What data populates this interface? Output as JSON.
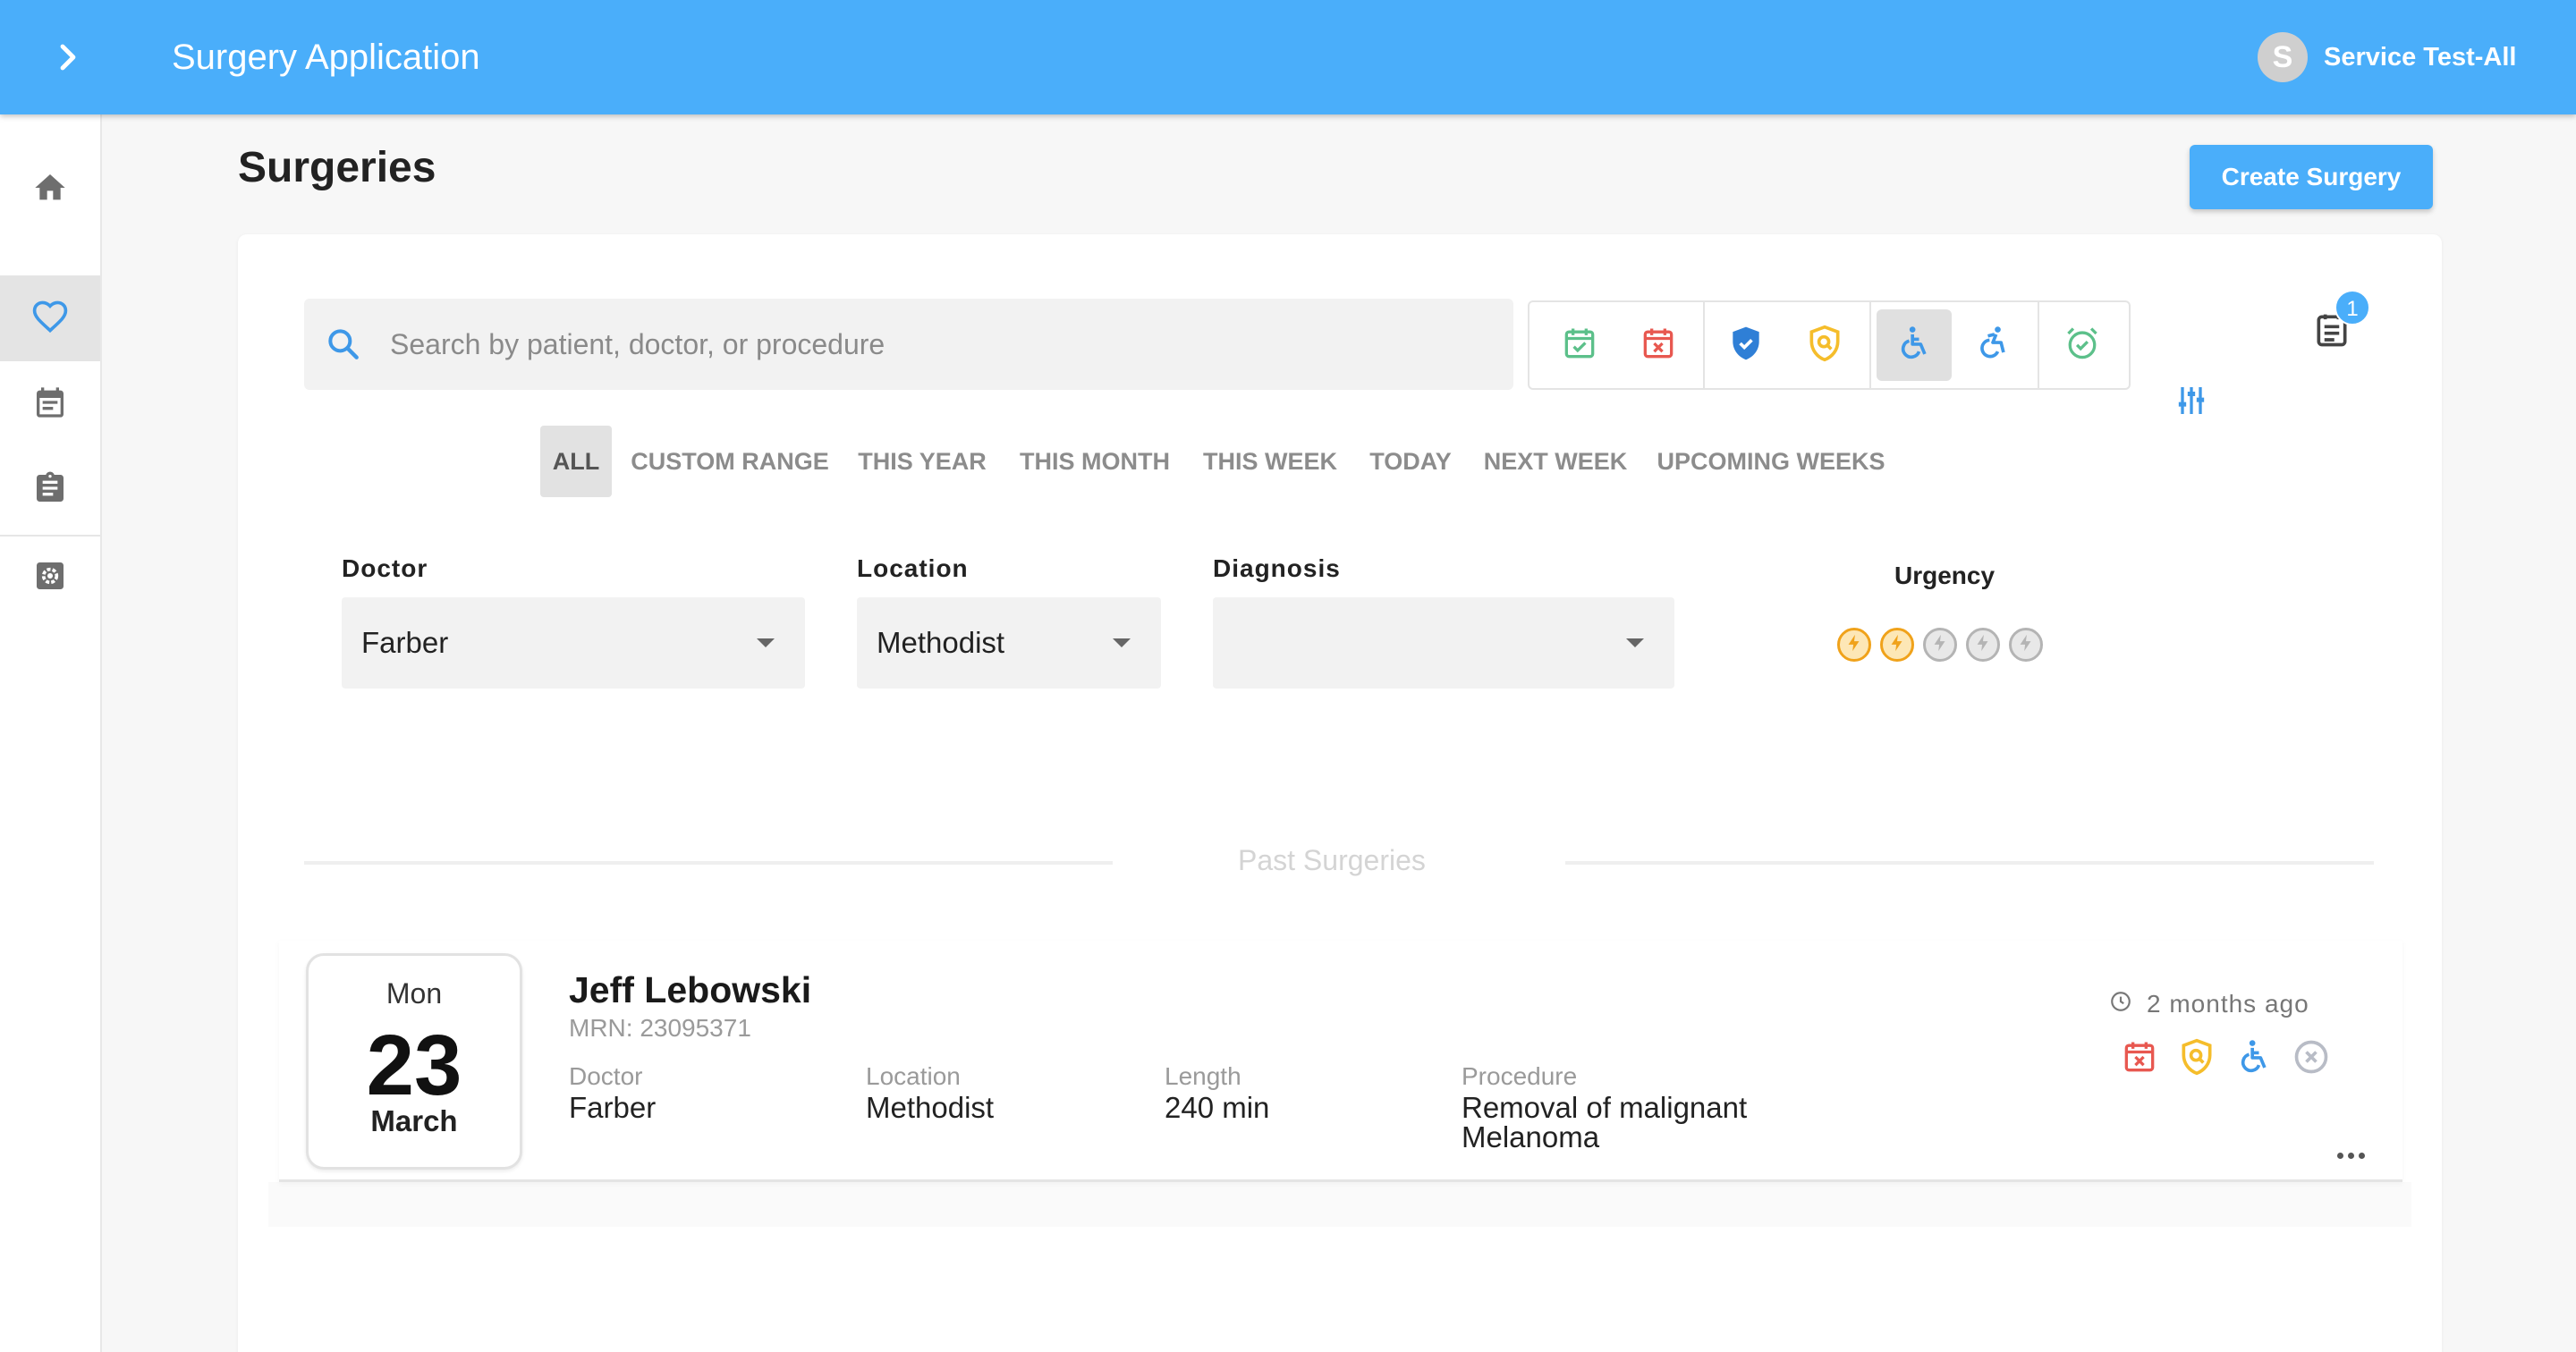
{
  "app": {
    "title": "Surgery Application"
  },
  "user": {
    "initial": "S",
    "name": "Service Test-All"
  },
  "sidebar": {
    "items": [
      {
        "icon": "home-icon",
        "active": false
      },
      {
        "icon": "heart-icon",
        "active": true
      },
      {
        "icon": "calendar-icon",
        "active": false
      },
      {
        "icon": "clipboard-icon",
        "active": false
      },
      {
        "icon": "settings-icon",
        "active": false
      }
    ]
  },
  "page": {
    "title": "Surgeries",
    "create_label": "Create Surgery"
  },
  "search": {
    "placeholder": "Search by patient, doctor, or procedure",
    "value": ""
  },
  "status_filters": [
    {
      "icon": "calendar-check-icon",
      "color": "#5cc08a",
      "selected": false
    },
    {
      "icon": "calendar-x-icon",
      "color": "#e85850",
      "selected": false
    },
    {
      "icon": "shield-check-icon",
      "color": "#2f7fd6",
      "selected": false
    },
    {
      "icon": "shield-search-icon",
      "color": "#f5bd2b",
      "selected": false
    },
    {
      "icon": "wheelchair-icon",
      "color": "#3e98e8",
      "selected": true
    },
    {
      "icon": "wheelchair-moving-icon",
      "color": "#3e98e8",
      "selected": false
    },
    {
      "icon": "alarm-check-icon",
      "color": "#5cc08a",
      "selected": false
    }
  ],
  "notes": {
    "badge": "1"
  },
  "date_ranges": [
    "ALL",
    "CUSTOM RANGE",
    "THIS YEAR",
    "THIS MONTH",
    "THIS WEEK",
    "TODAY",
    "NEXT WEEK",
    "UPCOMING WEEKS"
  ],
  "active_range": "ALL",
  "filters": {
    "doctor": {
      "label": "Doctor",
      "value": "Farber"
    },
    "location": {
      "label": "Location",
      "value": "Methodist"
    },
    "diagnosis": {
      "label": "Diagnosis",
      "value": ""
    },
    "urgency": {
      "label": "Urgency",
      "level": 2,
      "max": 5
    }
  },
  "section": {
    "title": "Past Surgeries"
  },
  "surgeries": [
    {
      "date": {
        "dow": "Mon",
        "day": "23",
        "month": "March"
      },
      "patient": "Jeff Lebowski",
      "mrn": "MRN: 23095371",
      "fields": [
        {
          "label": "Doctor",
          "value": "Farber"
        },
        {
          "label": "Location",
          "value": "Methodist"
        },
        {
          "label": "Length",
          "value": "240 min"
        },
        {
          "label": "Procedure",
          "value": "Removal of malignant Melanoma"
        }
      ],
      "time_ago": "2 months ago",
      "status_icons": [
        "calendar-x-icon",
        "shield-search-icon",
        "wheelchair-icon",
        "circle-x-icon"
      ]
    }
  ],
  "colors": {
    "accent": "#4aaefa",
    "urgency_on": "#f0a21a",
    "urgency_off": "#b4b4b4"
  }
}
